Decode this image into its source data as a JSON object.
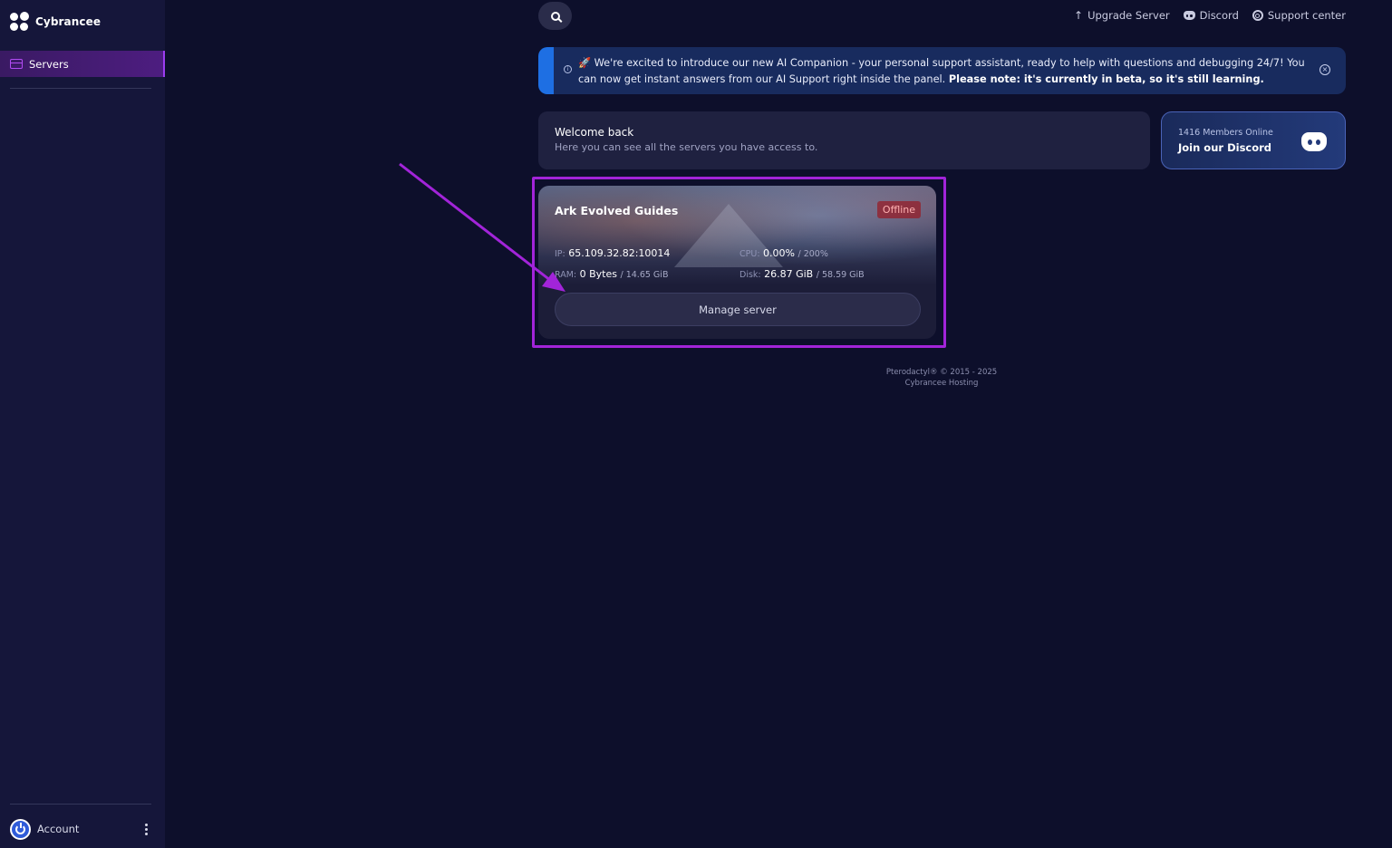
{
  "brand": {
    "name": "Cybrancee",
    "icon": "cybrancee-logo-icon"
  },
  "sidebar": {
    "items": [
      {
        "label": "Servers",
        "icon": "server-icon",
        "active": true
      }
    ],
    "account": {
      "label": "Account",
      "icon": "power-icon",
      "menu_icon": "kebab-menu-icon"
    }
  },
  "topnav": {
    "search_icon": "search-icon",
    "links": [
      {
        "label": "Upgrade Server",
        "icon": "arrow-up-icon"
      },
      {
        "label": "Discord",
        "icon": "discord-icon"
      },
      {
        "label": "Support center",
        "icon": "lifebuoy-icon"
      }
    ]
  },
  "announcement": {
    "text": "🚀 We're excited to introduce our new AI Companion - your personal support assistant, ready to help with questions and debugging 24/7! You can now get instant answers from our AI Support right inside the panel. ",
    "bold": "Please note: it's currently in beta, so it's still learning.",
    "icon": "info-icon",
    "close_icon": "close-icon",
    "accent_color": "#1e6fe3"
  },
  "welcome": {
    "title": "Welcome back",
    "subtitle": "Here you can see all the servers you have access to."
  },
  "discord_card": {
    "members": "1416 Members Online",
    "cta": "Join our Discord",
    "icon": "discord-icon"
  },
  "server": {
    "name": "Ark Evolved Guides",
    "status": "Offline",
    "status_color": "#c0303c",
    "ip_label": "IP:",
    "ip": "65.109.32.82:10014",
    "cpu_label": "CPU:",
    "cpu": "0.00%",
    "cpu_max": "/ 200%",
    "ram_label": "RAM:",
    "ram": "0 Bytes",
    "ram_max": "/ 14.65 GiB",
    "disk_label": "Disk:",
    "disk": "26.87 GiB",
    "disk_max": "/ 58.59 GiB",
    "manage_label": "Manage server"
  },
  "annotation": {
    "highlight_color": "#a224d9"
  },
  "footer": {
    "line1": "Pterodactyl® © 2015 - 2025",
    "line2": "Cybrancee Hosting"
  }
}
